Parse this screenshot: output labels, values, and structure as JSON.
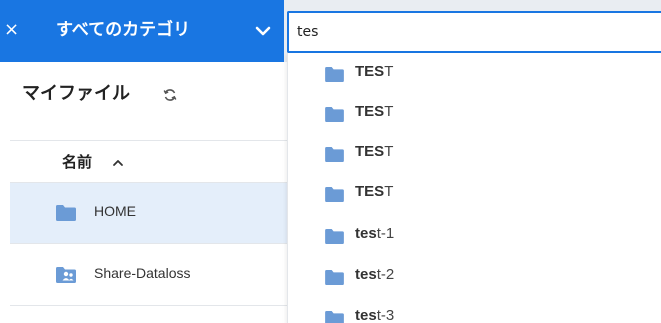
{
  "header": {
    "close_glyph": "×",
    "category": "すべてのカテゴリ",
    "search_value": "tes",
    "accent": "#1976e2"
  },
  "page": {
    "title": "マイファイル",
    "column_name": "名前"
  },
  "files": [
    {
      "name": "HOME",
      "icon": "folder-icon",
      "selected": true
    },
    {
      "name": "Share-Dataloss",
      "icon": "shared-folder-icon",
      "selected": false
    }
  ],
  "suggestions": [
    {
      "match": "TES",
      "rest": "T"
    },
    {
      "match": "TES",
      "rest": "T"
    },
    {
      "match": "TES",
      "rest": "T"
    },
    {
      "match": "TES",
      "rest": "T"
    },
    {
      "match": "tes",
      "rest": "t-1"
    },
    {
      "match": "tes",
      "rest": "t-2"
    },
    {
      "match": "tes",
      "rest": "t-3"
    }
  ],
  "colors": {
    "folder": "#6b9bd6",
    "selected_row": "#e4eefa"
  }
}
